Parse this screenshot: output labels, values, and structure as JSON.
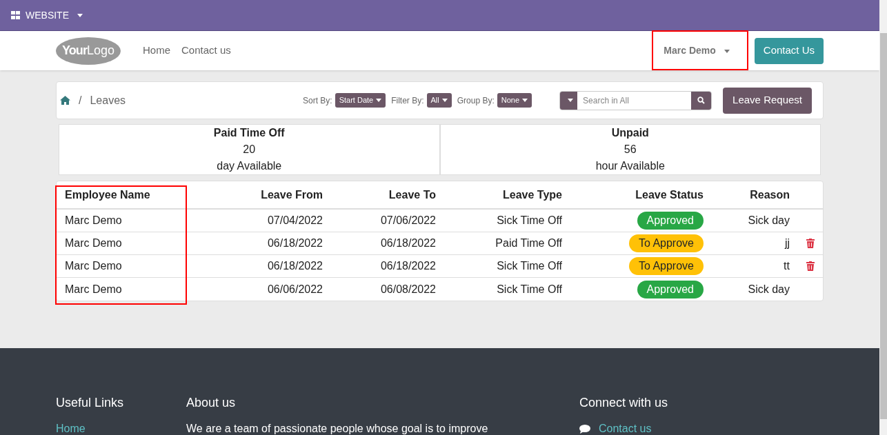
{
  "topbar": {
    "label": "WEBSITE"
  },
  "navbar": {
    "logo": {
      "bold": "Your",
      "light": "Logo"
    },
    "links": [
      "Home",
      "Contact us"
    ],
    "user": "Marc Demo",
    "cta": "Contact Us"
  },
  "breadcrumb": {
    "separator": "/",
    "current": "Leaves"
  },
  "controls": {
    "sort": {
      "label": "Sort By:",
      "value": "Start Date"
    },
    "filter": {
      "label": "Filter By:",
      "value": "All"
    },
    "group": {
      "label": "Group By:",
      "value": "None"
    },
    "search": {
      "placeholder": "Search in All"
    },
    "request_button": "Leave Request"
  },
  "summary": [
    {
      "title": "Paid Time Off",
      "amount": "20",
      "unit": "day Available"
    },
    {
      "title": "Unpaid",
      "amount": "56",
      "unit": "hour Available"
    }
  ],
  "table": {
    "columns": [
      "Employee Name",
      "Leave From",
      "Leave To",
      "Leave Type",
      "Leave Status",
      "Reason"
    ],
    "rows": [
      {
        "employee": "Marc Demo",
        "from": "07/04/2022",
        "to": "07/06/2022",
        "type": "Sick Time Off",
        "status": "Approved",
        "kind": "approved",
        "reason": "Sick day",
        "deletable": false
      },
      {
        "employee": "Marc Demo",
        "from": "06/18/2022",
        "to": "06/18/2022",
        "type": "Paid Time Off",
        "status": "To Approve",
        "kind": "pending",
        "reason": "jj",
        "deletable": true
      },
      {
        "employee": "Marc Demo",
        "from": "06/18/2022",
        "to": "06/18/2022",
        "type": "Sick Time Off",
        "status": "To Approve",
        "kind": "pending",
        "reason": "tt",
        "deletable": true
      },
      {
        "employee": "Marc Demo",
        "from": "06/06/2022",
        "to": "06/08/2022",
        "type": "Sick Time Off",
        "status": "Approved",
        "kind": "approved",
        "reason": "Sick day",
        "deletable": false
      }
    ]
  },
  "footer": {
    "columns": [
      {
        "heading": "Useful Links",
        "link": "Home"
      },
      {
        "heading": "About us",
        "text": "We are a team of passionate people whose goal is to improve"
      },
      {
        "heading": "Connect with us",
        "contact": "Contact us"
      }
    ]
  }
}
